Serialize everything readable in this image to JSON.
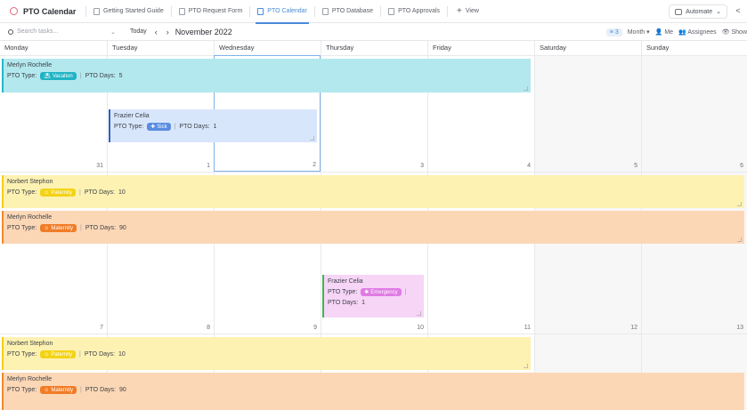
{
  "app": {
    "title": "PTO Calendar"
  },
  "tabs": [
    {
      "label": "Getting Started Guide",
      "active": false
    },
    {
      "label": "PTO Request Form",
      "active": false
    },
    {
      "label": "PTO Calendar",
      "active": true
    },
    {
      "label": "PTO Database",
      "active": false
    },
    {
      "label": "PTO Approvals",
      "active": false
    }
  ],
  "add_view_label": "View",
  "automate_label": "Automate",
  "toolbar": {
    "search_placeholder": "Search tasks...",
    "today_label": "Today",
    "month_title": "November 2022",
    "filter_count": "3",
    "view_mode": "Month",
    "me_label": "Me",
    "assignees_label": "Assignees",
    "show_label": "Show"
  },
  "days_of_week": [
    "Monday",
    "Tuesday",
    "Wednesday",
    "Thursday",
    "Friday",
    "Saturday",
    "Sunday"
  ],
  "weeks": [
    {
      "days": [
        "31",
        "1",
        "2",
        "3",
        "4",
        "5",
        "6"
      ]
    },
    {
      "days": [
        "7",
        "8",
        "9",
        "10",
        "11",
        "12",
        "13"
      ]
    },
    {
      "days": [
        "",
        "",
        "",
        "",
        "",
        "",
        ""
      ]
    }
  ],
  "field_labels": {
    "type": "PTO Type:",
    "days": "PTO Days:"
  },
  "colors": {
    "vacation_bg": "#b3e8ee",
    "vacation_border": "#27b7c6",
    "vacation_pill": "#1fb3c4",
    "sick_bg": "#d8e6fb",
    "sick_border": "#2e5fc4",
    "sick_pill": "#5a8de0",
    "paternity_bg": "#fdf2b2",
    "paternity_border": "#f3cf16",
    "paternity_pill": "#f3d315",
    "maternity_bg": "#fcd7b6",
    "maternity_border": "#f08a2d",
    "maternity_pill": "#f17c26",
    "emergency_bg": "#f6d5f7",
    "emergency_border": "#3fb64d",
    "emergency_pill": "#e07be3"
  },
  "events": [
    {
      "name": "Merlyn Rochelle",
      "type": "Vacation",
      "days": "5"
    },
    {
      "name": "Frazier Celia",
      "type": "Sick",
      "days": "1"
    },
    {
      "name": "Norbert Stephon",
      "type": "Paternity",
      "days": "10"
    },
    {
      "name": "Merlyn Rochelle",
      "type": "Maternity",
      "days": "90"
    },
    {
      "name": "Frazier Celia",
      "type": "Emergency",
      "days": "1"
    },
    {
      "name": "Norbert Stephon",
      "type": "Paternity",
      "days": "10"
    },
    {
      "name": "Merlyn Rochelle",
      "type": "Maternity",
      "days": "90"
    }
  ]
}
